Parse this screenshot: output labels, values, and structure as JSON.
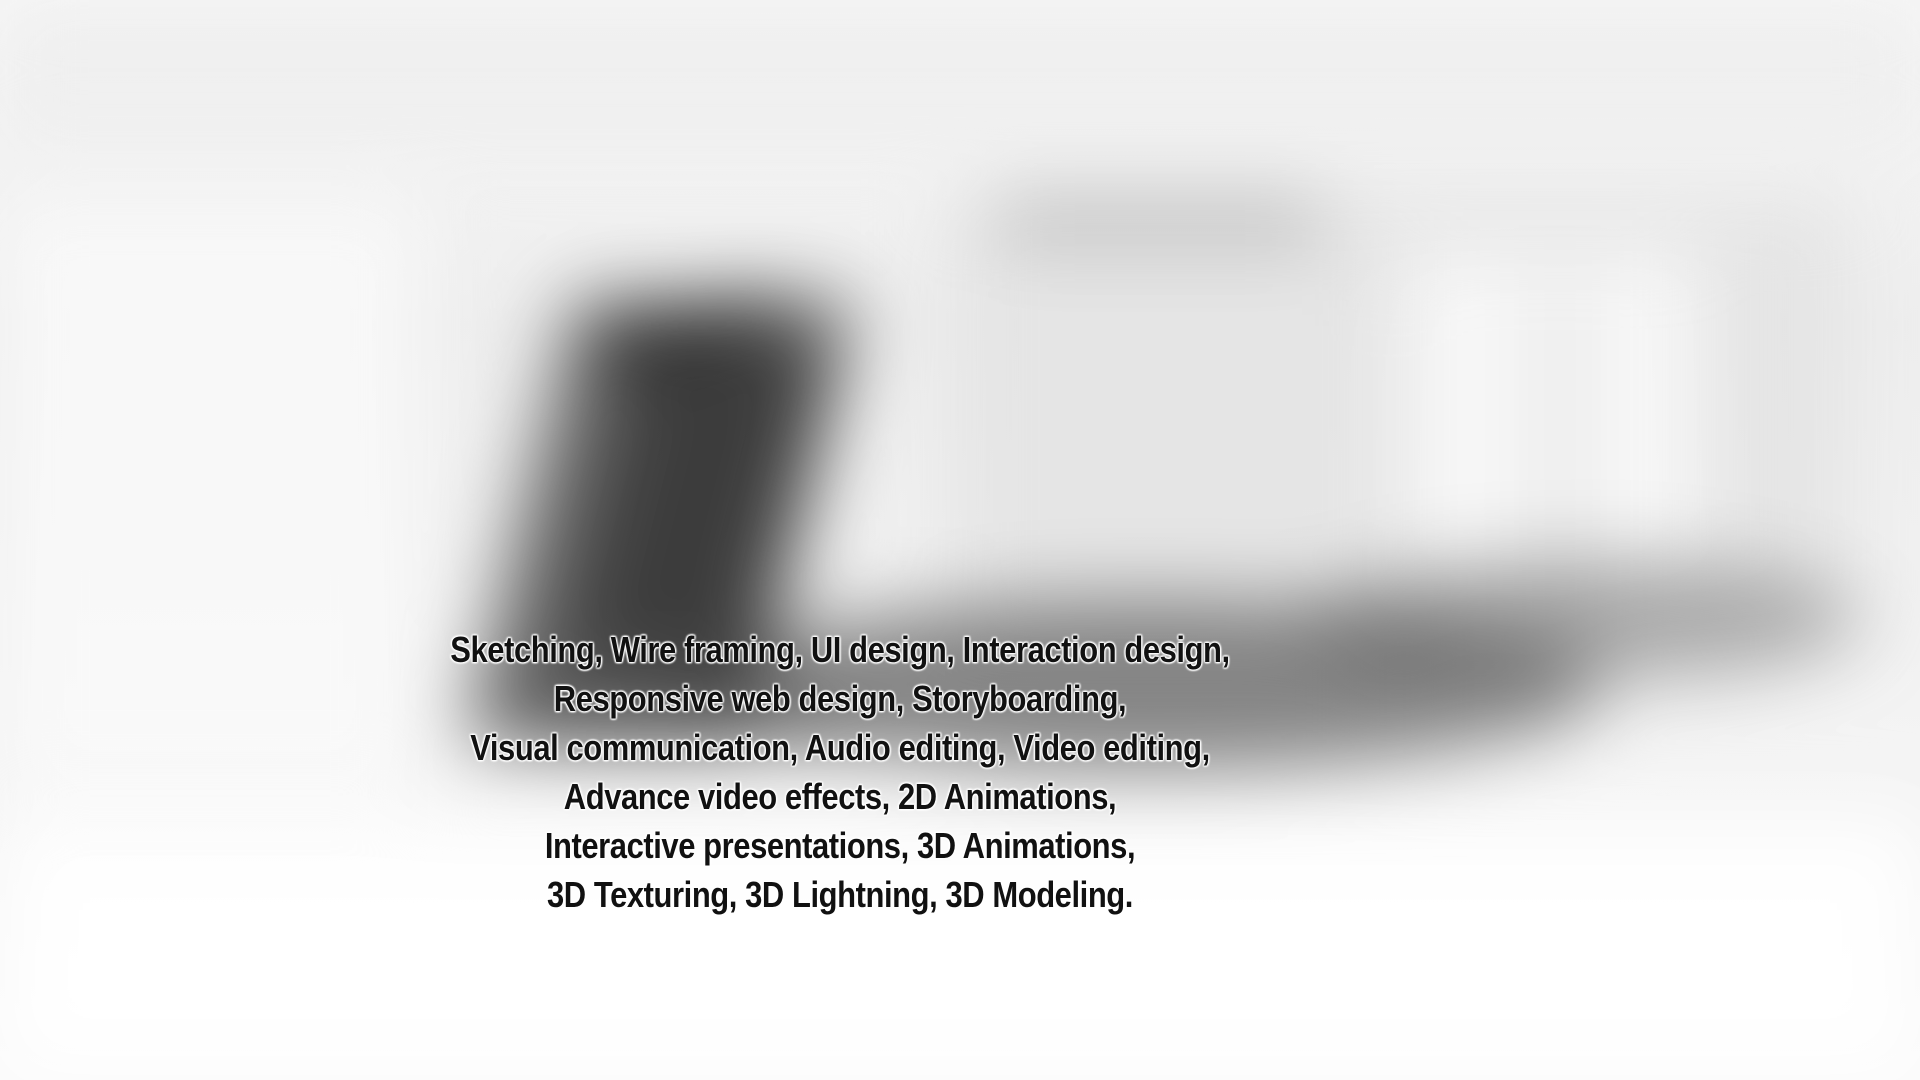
{
  "skills": {
    "lines": [
      "Sketching, Wire framing, UI design, Interaction design,",
      "Responsive web design, Storyboarding,",
      "Visual communication, Audio editing, Video editing,",
      "Advance video effects, 2D Animations,",
      "Interactive presentations, 3D Animations,",
      "3D Texturing, 3D Lightning, 3D Modeling."
    ]
  },
  "colors": {
    "text": "#111111",
    "text_glow": "#ffffff",
    "background": "#f4f4f4"
  }
}
